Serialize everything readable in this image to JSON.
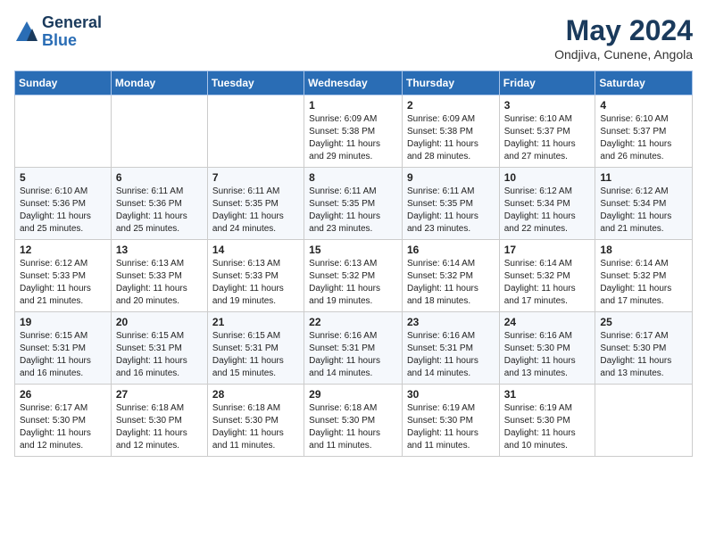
{
  "header": {
    "logo_general": "General",
    "logo_blue": "Blue",
    "month_year": "May 2024",
    "location": "Ondjiva, Cunene, Angola"
  },
  "days_of_week": [
    "Sunday",
    "Monday",
    "Tuesday",
    "Wednesday",
    "Thursday",
    "Friday",
    "Saturday"
  ],
  "weeks": [
    [
      {
        "day": "",
        "detail": ""
      },
      {
        "day": "",
        "detail": ""
      },
      {
        "day": "",
        "detail": ""
      },
      {
        "day": "1",
        "detail": "Sunrise: 6:09 AM\nSunset: 5:38 PM\nDaylight: 11 hours\nand 29 minutes."
      },
      {
        "day": "2",
        "detail": "Sunrise: 6:09 AM\nSunset: 5:38 PM\nDaylight: 11 hours\nand 28 minutes."
      },
      {
        "day": "3",
        "detail": "Sunrise: 6:10 AM\nSunset: 5:37 PM\nDaylight: 11 hours\nand 27 minutes."
      },
      {
        "day": "4",
        "detail": "Sunrise: 6:10 AM\nSunset: 5:37 PM\nDaylight: 11 hours\nand 26 minutes."
      }
    ],
    [
      {
        "day": "5",
        "detail": "Sunrise: 6:10 AM\nSunset: 5:36 PM\nDaylight: 11 hours\nand 25 minutes."
      },
      {
        "day": "6",
        "detail": "Sunrise: 6:11 AM\nSunset: 5:36 PM\nDaylight: 11 hours\nand 25 minutes."
      },
      {
        "day": "7",
        "detail": "Sunrise: 6:11 AM\nSunset: 5:35 PM\nDaylight: 11 hours\nand 24 minutes."
      },
      {
        "day": "8",
        "detail": "Sunrise: 6:11 AM\nSunset: 5:35 PM\nDaylight: 11 hours\nand 23 minutes."
      },
      {
        "day": "9",
        "detail": "Sunrise: 6:11 AM\nSunset: 5:35 PM\nDaylight: 11 hours\nand 23 minutes."
      },
      {
        "day": "10",
        "detail": "Sunrise: 6:12 AM\nSunset: 5:34 PM\nDaylight: 11 hours\nand 22 minutes."
      },
      {
        "day": "11",
        "detail": "Sunrise: 6:12 AM\nSunset: 5:34 PM\nDaylight: 11 hours\nand 21 minutes."
      }
    ],
    [
      {
        "day": "12",
        "detail": "Sunrise: 6:12 AM\nSunset: 5:33 PM\nDaylight: 11 hours\nand 21 minutes."
      },
      {
        "day": "13",
        "detail": "Sunrise: 6:13 AM\nSunset: 5:33 PM\nDaylight: 11 hours\nand 20 minutes."
      },
      {
        "day": "14",
        "detail": "Sunrise: 6:13 AM\nSunset: 5:33 PM\nDaylight: 11 hours\nand 19 minutes."
      },
      {
        "day": "15",
        "detail": "Sunrise: 6:13 AM\nSunset: 5:32 PM\nDaylight: 11 hours\nand 19 minutes."
      },
      {
        "day": "16",
        "detail": "Sunrise: 6:14 AM\nSunset: 5:32 PM\nDaylight: 11 hours\nand 18 minutes."
      },
      {
        "day": "17",
        "detail": "Sunrise: 6:14 AM\nSunset: 5:32 PM\nDaylight: 11 hours\nand 17 minutes."
      },
      {
        "day": "18",
        "detail": "Sunrise: 6:14 AM\nSunset: 5:32 PM\nDaylight: 11 hours\nand 17 minutes."
      }
    ],
    [
      {
        "day": "19",
        "detail": "Sunrise: 6:15 AM\nSunset: 5:31 PM\nDaylight: 11 hours\nand 16 minutes."
      },
      {
        "day": "20",
        "detail": "Sunrise: 6:15 AM\nSunset: 5:31 PM\nDaylight: 11 hours\nand 16 minutes."
      },
      {
        "day": "21",
        "detail": "Sunrise: 6:15 AM\nSunset: 5:31 PM\nDaylight: 11 hours\nand 15 minutes."
      },
      {
        "day": "22",
        "detail": "Sunrise: 6:16 AM\nSunset: 5:31 PM\nDaylight: 11 hours\nand 14 minutes."
      },
      {
        "day": "23",
        "detail": "Sunrise: 6:16 AM\nSunset: 5:31 PM\nDaylight: 11 hours\nand 14 minutes."
      },
      {
        "day": "24",
        "detail": "Sunrise: 6:16 AM\nSunset: 5:30 PM\nDaylight: 11 hours\nand 13 minutes."
      },
      {
        "day": "25",
        "detail": "Sunrise: 6:17 AM\nSunset: 5:30 PM\nDaylight: 11 hours\nand 13 minutes."
      }
    ],
    [
      {
        "day": "26",
        "detail": "Sunrise: 6:17 AM\nSunset: 5:30 PM\nDaylight: 11 hours\nand 12 minutes."
      },
      {
        "day": "27",
        "detail": "Sunrise: 6:18 AM\nSunset: 5:30 PM\nDaylight: 11 hours\nand 12 minutes."
      },
      {
        "day": "28",
        "detail": "Sunrise: 6:18 AM\nSunset: 5:30 PM\nDaylight: 11 hours\nand 11 minutes."
      },
      {
        "day": "29",
        "detail": "Sunrise: 6:18 AM\nSunset: 5:30 PM\nDaylight: 11 hours\nand 11 minutes."
      },
      {
        "day": "30",
        "detail": "Sunrise: 6:19 AM\nSunset: 5:30 PM\nDaylight: 11 hours\nand 11 minutes."
      },
      {
        "day": "31",
        "detail": "Sunrise: 6:19 AM\nSunset: 5:30 PM\nDaylight: 11 hours\nand 10 minutes."
      },
      {
        "day": "",
        "detail": ""
      }
    ]
  ]
}
